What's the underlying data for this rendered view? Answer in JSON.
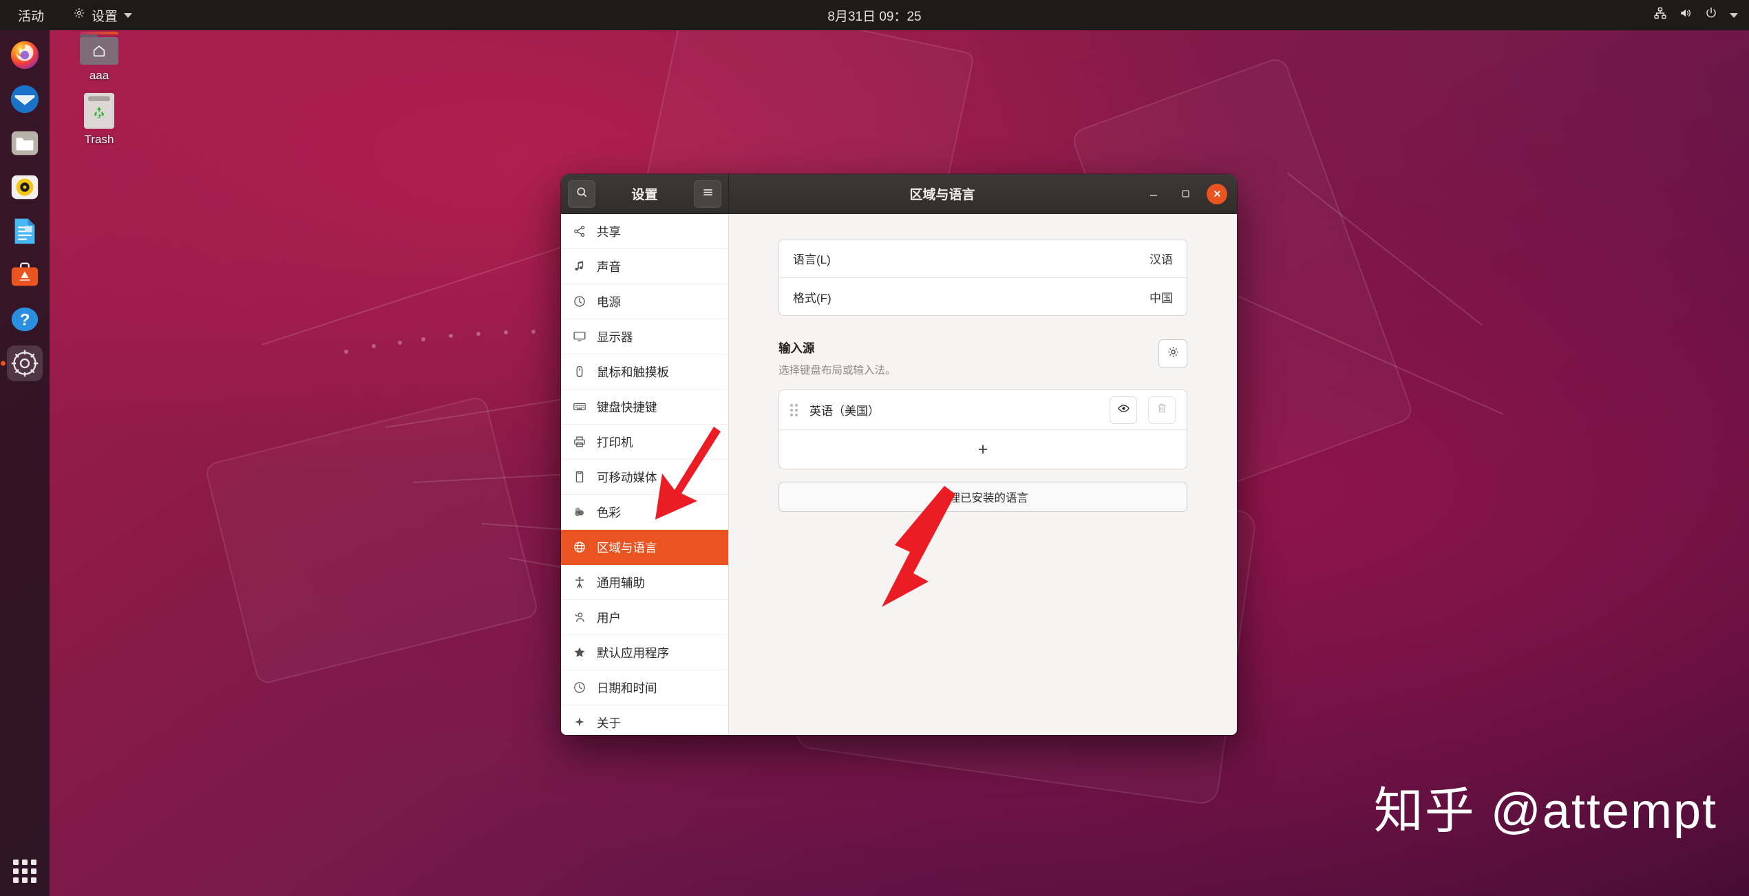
{
  "topbar": {
    "activities": "活动",
    "app_menu": "设置",
    "clock": "8月31日  09：25",
    "icons": [
      "network-icon",
      "volume-icon",
      "power-icon",
      "caret-down-icon"
    ]
  },
  "dock": {
    "items": [
      {
        "name": "firefox",
        "label": "Firefox"
      },
      {
        "name": "thunderbird",
        "label": "Thunderbird"
      },
      {
        "name": "files",
        "label": "Files"
      },
      {
        "name": "rhythmbox",
        "label": "Rhythmbox"
      },
      {
        "name": "libreoffice-writer",
        "label": "LibreOffice Writer"
      },
      {
        "name": "ubuntu-software",
        "label": "Ubuntu Software"
      },
      {
        "name": "help",
        "label": "Help"
      },
      {
        "name": "settings",
        "label": "Settings"
      }
    ],
    "show_apps": "show-applications"
  },
  "desktop": {
    "icons": [
      {
        "name": "home-folder",
        "label": "aaa"
      },
      {
        "name": "trash",
        "label": "Trash"
      }
    ]
  },
  "window": {
    "header_app_title": "设置",
    "page_title": "区域与语言",
    "search_icon": "search-icon",
    "menu_icon": "hamburger-menu-icon",
    "minimize": "—",
    "maximize": "▢",
    "close": "✕"
  },
  "sidebar": {
    "items": [
      {
        "label": "共享",
        "icon": "share-icon",
        "selected": false
      },
      {
        "label": "声音",
        "icon": "sound-icon",
        "selected": false
      },
      {
        "label": "电源",
        "icon": "power-icon",
        "selected": false
      },
      {
        "label": "显示器",
        "icon": "display-icon",
        "selected": false
      },
      {
        "label": "鼠标和触摸板",
        "icon": "mouse-icon",
        "selected": false
      },
      {
        "label": "键盘快捷键",
        "icon": "keyboard-icon",
        "selected": false
      },
      {
        "label": "打印机",
        "icon": "printer-icon",
        "selected": false
      },
      {
        "label": "可移动媒体",
        "icon": "removable-media-icon",
        "selected": false
      },
      {
        "label": "色彩",
        "icon": "color-icon",
        "selected": false
      },
      {
        "label": "区域与语言",
        "icon": "globe-icon",
        "selected": true
      },
      {
        "label": "通用辅助",
        "icon": "accessibility-icon",
        "selected": false
      },
      {
        "label": "用户",
        "icon": "users-icon",
        "selected": false
      },
      {
        "label": "默认应用程序",
        "icon": "star-icon",
        "selected": false
      },
      {
        "label": "日期和时间",
        "icon": "clock-icon",
        "selected": false
      },
      {
        "label": "关于",
        "icon": "sparkle-icon",
        "selected": false
      }
    ]
  },
  "content": {
    "language_row": {
      "label": "语言(L)",
      "value": "汉语"
    },
    "format_row": {
      "label": "格式(F)",
      "value": "中国"
    },
    "input_sources": {
      "title": "输入源",
      "subtitle": "选择键盘布局或输入法。",
      "settings_icon": "gear-icon",
      "items": [
        {
          "name": "英语（美国）",
          "preview_icon": "eye-icon",
          "remove_icon": "trash-icon"
        }
      ],
      "add_label": "+"
    },
    "manage_button": "管理已安装的语言"
  },
  "annotations": {
    "arrow_color": "#ec1c24",
    "arrows": [
      {
        "name": "arrow-to-region-language",
        "points_at": "区域与语言"
      },
      {
        "name": "arrow-to-manage-languages",
        "points_at": "管理已安装的语言"
      }
    ]
  },
  "watermark": "知乎 @attempt",
  "colors": {
    "accent_orange": "#e95420",
    "topbar_bg": "#1d1b1a",
    "titlebar_bg": "#302d2b",
    "content_bg": "#f5f4f3"
  }
}
